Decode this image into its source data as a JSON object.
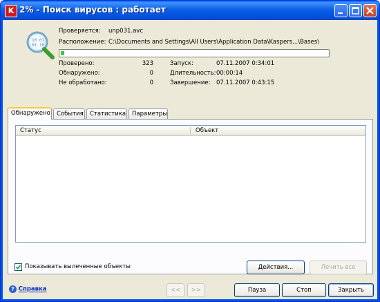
{
  "window": {
    "title": "2% - Поиск вирусов : работает",
    "app_icon_letter": "K"
  },
  "scan": {
    "current_label": "Проверяется:",
    "current_value": "unp031.avc",
    "location_label": "Расположение:",
    "location_value": "C:\\Documents and Settings\\All Users\\Application Data\\Kaspers...\\Bases\\",
    "progress_percent": 2,
    "stats": {
      "checked_label": "Проверено:",
      "checked_value": "323",
      "found_label": "Обнаружено:",
      "found_value": "0",
      "unprocessed_label": "Не обработано:",
      "unprocessed_value": "0",
      "start_label": "Запуск:",
      "start_value": "07.11.2007 0:34:01",
      "duration_label": "Длительность:",
      "duration_value": "00:00:14",
      "end_label": "Завершение:",
      "end_value": "07.11.2007 0:43:15"
    }
  },
  "tabs": [
    {
      "label": "Обнаружено",
      "active": true
    },
    {
      "label": "События",
      "active": false
    },
    {
      "label": "Статистика",
      "active": false
    },
    {
      "label": "Параметры",
      "active": false
    }
  ],
  "list": {
    "columns": [
      "Статус",
      "Объект"
    ],
    "rows": []
  },
  "options": {
    "show_cured_label": "Показывать вылеченные объекты",
    "show_cured_checked": true
  },
  "buttons": {
    "actions": "Действия...",
    "cure_all": "Лечить все",
    "back": "<<",
    "forward": ">>",
    "pause": "Пауза",
    "stop": "Стоп",
    "close": "Закрыть"
  },
  "help": {
    "label": "Справка"
  },
  "icons": {
    "window": [
      "minimize-icon",
      "maximize-icon",
      "close-icon"
    ],
    "scan": "magnifier-scan-icon",
    "help": "help-icon",
    "checkbox": "checkmark-icon"
  },
  "colors": {
    "titlebar": "#0055e5",
    "progress_fill": "#3bcc3b",
    "close_button": "#c8401c",
    "active_tab_accent": "#ffc83c",
    "link": "#0a2ec2"
  }
}
